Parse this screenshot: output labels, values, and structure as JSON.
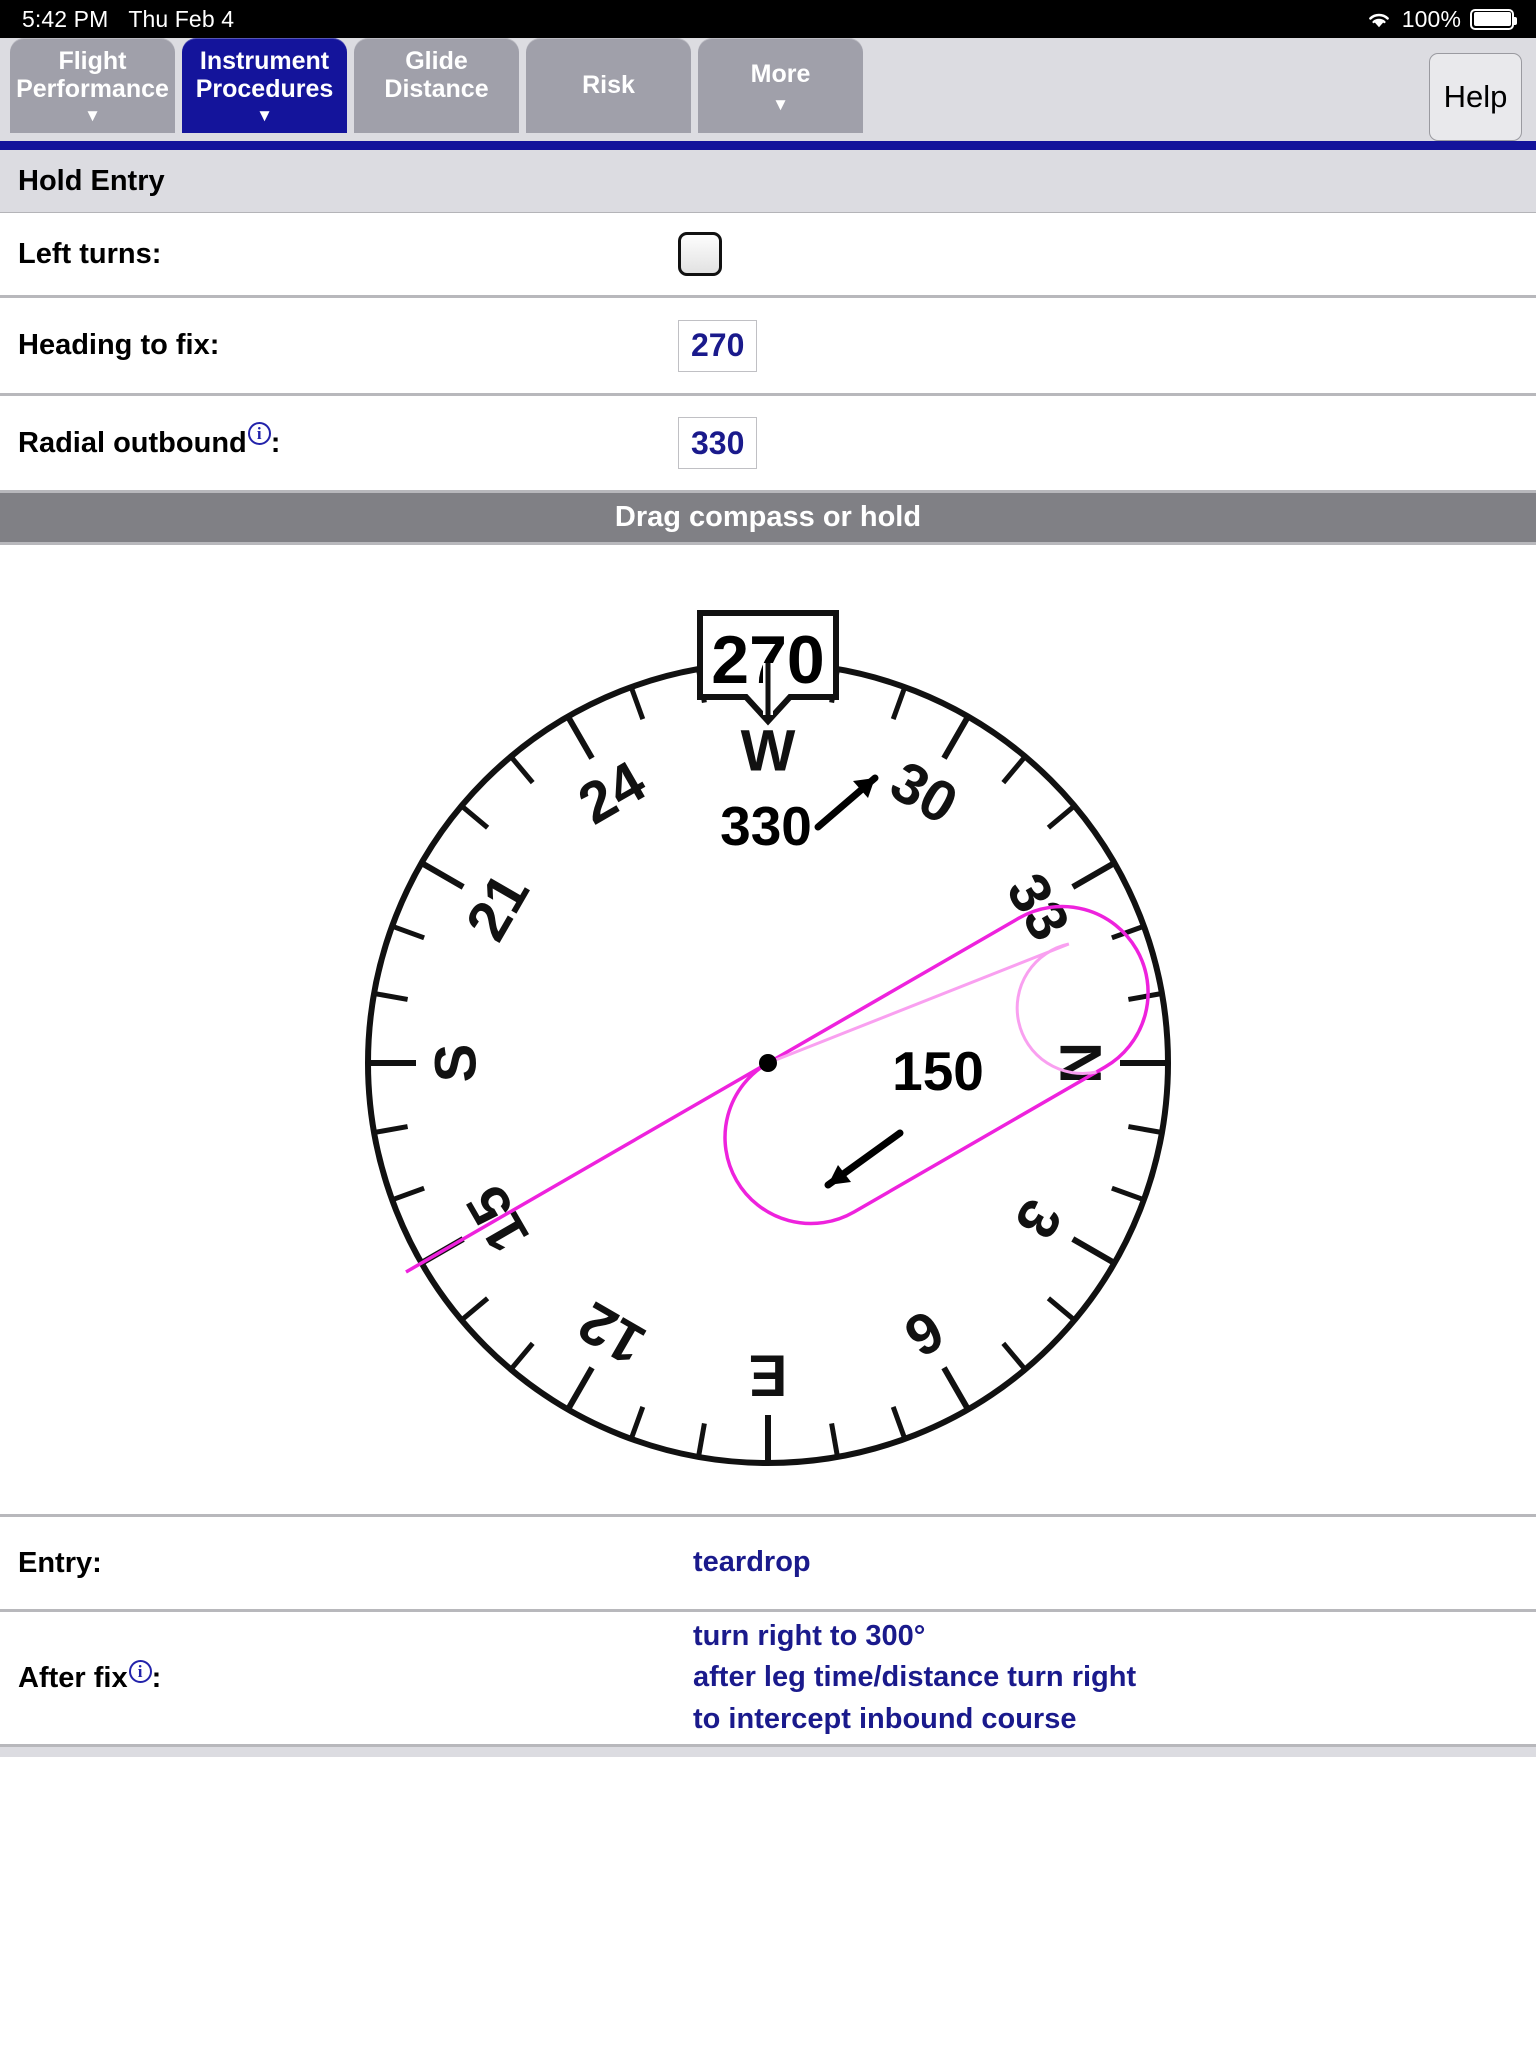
{
  "status_bar": {
    "time": "5:42 PM",
    "date": "Thu Feb 4",
    "wifi_icon": "wifi-icon",
    "battery_percent": "100%",
    "battery_icon": "battery-full-icon"
  },
  "tabs": [
    {
      "label": "Flight\nPerformance",
      "active": false,
      "caret": "▼",
      "lines": 2
    },
    {
      "label": "Instrument\nProcedures",
      "active": true,
      "caret": "▼",
      "lines": 2
    },
    {
      "label": "Glide\nDistance",
      "active": false,
      "caret": "",
      "lines": 2
    },
    {
      "label": "Risk",
      "active": false,
      "caret": "",
      "lines": 1
    },
    {
      "label": "More",
      "active": false,
      "caret": "▼",
      "lines": 1
    }
  ],
  "help_button": {
    "label": "Help"
  },
  "section": {
    "title": "Hold Entry"
  },
  "form": {
    "left_turns": {
      "label": "Left turns:",
      "checked": false
    },
    "heading_to_fix": {
      "label": "Heading to fix:",
      "value": "270"
    },
    "radial_outbound": {
      "label": "Radial outbound",
      "suffix": ":",
      "value": "330",
      "info_icon": "info-icon",
      "info_glyph": "i"
    }
  },
  "drag_bar": {
    "label": "Drag compass or hold"
  },
  "compass": {
    "heading_box_value": "270",
    "outbound_label": "330",
    "inbound_label": "150",
    "cardinal_labels": [
      {
        "text": "N",
        "deg": 0
      },
      {
        "text": "3",
        "deg": 30
      },
      {
        "text": "6",
        "deg": 60
      },
      {
        "text": "E",
        "deg": 90
      },
      {
        "text": "12",
        "deg": 120
      },
      {
        "text": "15",
        "deg": 150
      },
      {
        "text": "S",
        "deg": 180
      },
      {
        "text": "21",
        "deg": 210
      },
      {
        "text": "24",
        "deg": 240
      },
      {
        "text": "W",
        "deg": 270
      },
      {
        "text": "30",
        "deg": 300
      },
      {
        "text": "33",
        "deg": 330
      }
    ],
    "hold_color": "#ee22dd",
    "entry_path_color": "#f9a0f0",
    "ring_color": "#111111",
    "heading_deg": 270,
    "outbound_radial_deg": 330,
    "inbound_course_deg": 150,
    "turn_direction": "right"
  },
  "results": {
    "entry": {
      "label": "Entry:",
      "value": "teardrop"
    },
    "after_fix": {
      "label": "After fix",
      "suffix": ":",
      "info_icon": "info-icon",
      "info_glyph": "i",
      "lines": [
        "turn right to 300°",
        "after leg time/distance turn right",
        "to intercept inbound course"
      ]
    }
  }
}
